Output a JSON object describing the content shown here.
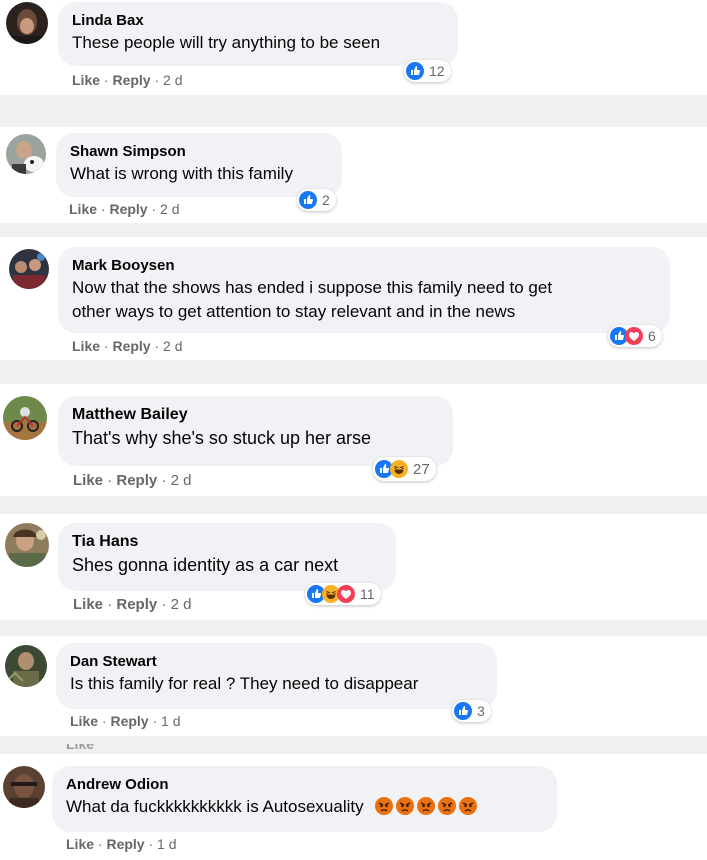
{
  "actions": {
    "like": "Like",
    "reply": "Reply",
    "dot": "·"
  },
  "colors": {
    "like_blue": "#1877f2",
    "love_red": "#f33e58",
    "haha_yellow": "#f7b125",
    "angry_orange": "#e9710f",
    "bubble": "#f0f2f5",
    "meta_gray": "#65676b"
  },
  "comments": [
    {
      "author": "Linda Bax",
      "text": "These people will try anything to be seen",
      "time": "2 d",
      "reactions": [
        "like"
      ],
      "reaction_count": "12"
    },
    {
      "author": "Shawn Simpson",
      "text": "What is wrong with this family",
      "time": "2 d",
      "reactions": [
        "like"
      ],
      "reaction_count": "2"
    },
    {
      "author": "Mark Booysen",
      "text_lines": [
        "Now that the shows has ended i suppose this family need to get",
        "other ways to get attention to stay relevant and in the news"
      ],
      "time": "2 d",
      "reactions": [
        "like",
        "love"
      ],
      "reaction_count": "6"
    },
    {
      "author": "Matthew Bailey",
      "text": "That's why she's so stuck up her arse",
      "time": "2 d",
      "reactions": [
        "like",
        "haha"
      ],
      "reaction_count": "27"
    },
    {
      "author": "Tia Hans",
      "text": "Shes gonna identity as a car next",
      "time": "2 d",
      "reactions": [
        "like",
        "haha",
        "love"
      ],
      "reaction_count": "11"
    },
    {
      "author": "Dan Stewart",
      "text": "Is this family for real ? They need to disappear",
      "time": "1 d",
      "reactions": [
        "like"
      ],
      "reaction_count": "3"
    },
    {
      "author": "Andrew Odion",
      "text": "What da fuckkkkkkkkkk is Autosexuality",
      "inline_emojis": [
        "angry-face",
        "angry-face",
        "angry-face",
        "angry-face",
        "angry-face"
      ],
      "time": "1 d",
      "reactions": [],
      "reaction_count": ""
    }
  ]
}
